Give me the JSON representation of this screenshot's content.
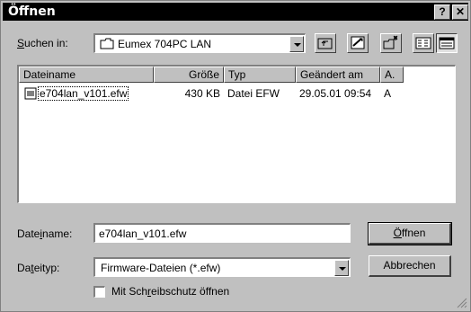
{
  "window": {
    "title": "Öffnen",
    "help_label": "?",
    "close_label": "✕"
  },
  "lookin": {
    "label_u": "S",
    "label_rest": "uchen in:",
    "value": "Eumex 704PC LAN"
  },
  "toolbar": {
    "icons": [
      "up-folder-icon",
      "desktop-icon",
      "new-folder-icon",
      "list-view-icon",
      "details-view-icon"
    ]
  },
  "filelist": {
    "columns": [
      "Dateiname",
      "Größe",
      "Typ",
      "Geändert am",
      "A."
    ],
    "rows": [
      {
        "name": "e704lan_v101.efw",
        "size": "430 KB",
        "type": "Datei EFW",
        "modified": "29.05.01 09:54",
        "attr": "A"
      }
    ]
  },
  "filename": {
    "label_pre": "Date",
    "label_u": "i",
    "label_post": "name:",
    "value": "e704lan_v101.efw"
  },
  "filetype": {
    "label_pre": "Da",
    "label_u": "t",
    "label_post": "eityp:",
    "value": "Firmware-Dateien (*.efw)"
  },
  "readonly": {
    "label_pre": "Mit Sch",
    "label_u": "r",
    "label_post": "eibschutz öffnen",
    "checked": false
  },
  "buttons": {
    "open_u": "Ö",
    "open_rest": "ffnen",
    "cancel": "Abbrechen"
  }
}
